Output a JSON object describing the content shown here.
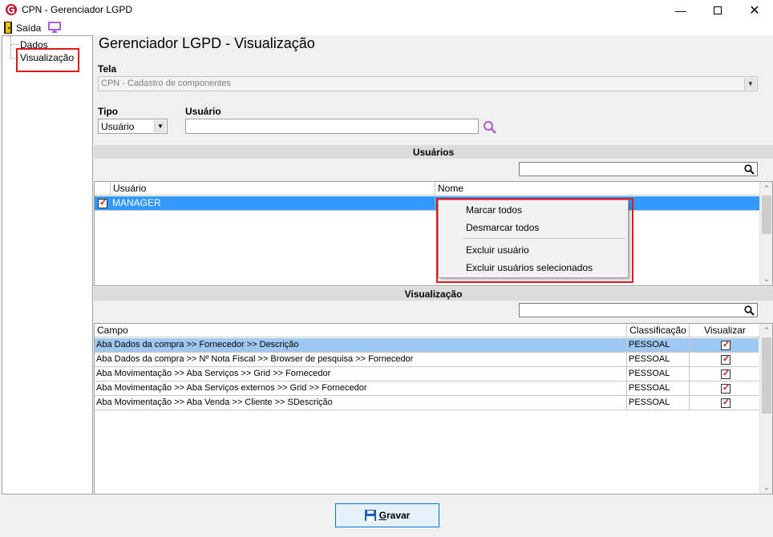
{
  "window": {
    "title": "CPN - Gerenciador LGPD"
  },
  "menu": {
    "exit_label": "Saída"
  },
  "tree": {
    "items": [
      {
        "label": "Dados"
      },
      {
        "label": "Visualização"
      }
    ]
  },
  "page": {
    "title": "Gerenciador LGPD - Visualização"
  },
  "tela": {
    "label": "Tela",
    "value": "CPN - Cadastro de componentes"
  },
  "tipo": {
    "label": "Tipo",
    "value": "Usuário"
  },
  "usuario": {
    "label": "Usuário",
    "value": ""
  },
  "users_section": {
    "title": "Usuários",
    "columns": [
      "Usuário",
      "Nome"
    ],
    "rows": [
      {
        "usuario": "MANAGER",
        "nome": "",
        "checked": true
      }
    ]
  },
  "context_menu": {
    "items": [
      "Marcar todos",
      "Desmarcar todos",
      "Excluir usuário",
      "Excluir usuários selecionados"
    ]
  },
  "view_section": {
    "title": "Visualização",
    "columns": [
      "Campo",
      "Classificação",
      "Visualizar"
    ],
    "rows": [
      {
        "campo": "Aba Dados da compra >> Fornecedor >> Descrição",
        "classificacao": "PESSOAL",
        "visualizar": true
      },
      {
        "campo": "Aba Dados da compra >> Nº Nota Fiscal >> Browser de pesquisa >> Fornecedor",
        "classificacao": "PESSOAL",
        "visualizar": true
      },
      {
        "campo": "Aba Movimentação >> Aba Serviços >> Grid >> Fornecedor",
        "classificacao": "PESSOAL",
        "visualizar": true
      },
      {
        "campo": "Aba Movimentação >> Aba Serviços externos >> Grid >> Fornecedor",
        "classificacao": "PESSOAL",
        "visualizar": true
      },
      {
        "campo": "Aba Movimentação >> Aba Venda >> Cliente >> SDescrição",
        "classificacao": "PESSOAL",
        "visualizar": true
      }
    ]
  },
  "save_button": {
    "label_first": "G",
    "label_rest": "ravar"
  },
  "colors": {
    "selection": "#3399ff",
    "highlight": "#e0191c",
    "section_bar": "#dcdcdc"
  }
}
